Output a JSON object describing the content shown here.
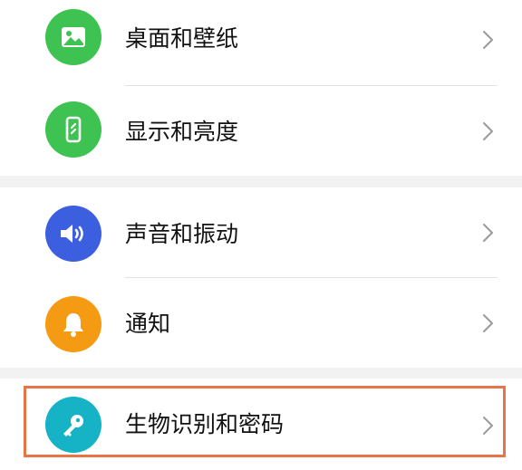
{
  "settings": {
    "items": [
      {
        "label": "桌面和壁纸",
        "icon": "image-icon",
        "color": "#3ec252"
      },
      {
        "label": "显示和亮度",
        "icon": "phone-display-icon",
        "color": "#3ec252"
      },
      {
        "label": "声音和振动",
        "icon": "speaker-icon",
        "color": "#3c5fe0"
      },
      {
        "label": "通知",
        "icon": "bell-icon",
        "color": "#f59a13"
      },
      {
        "label": "生物识别和密码",
        "icon": "key-icon",
        "color": "#16b3c6"
      }
    ],
    "highlight_color": "#e8744a"
  }
}
